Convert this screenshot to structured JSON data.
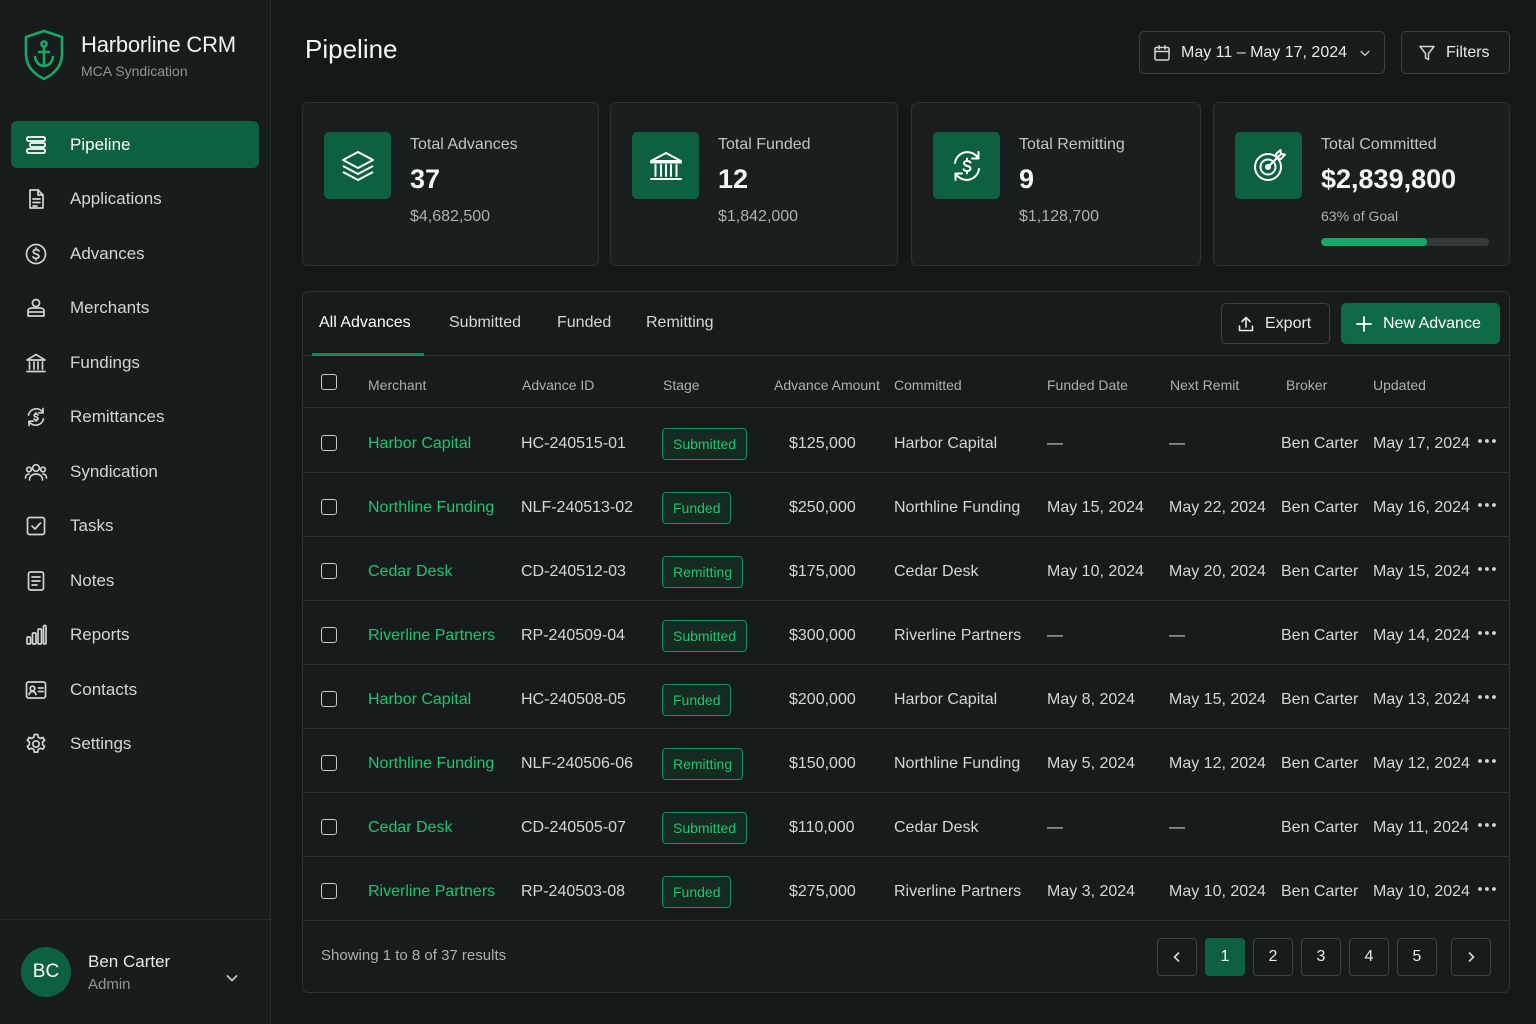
{
  "brand": {
    "title": "Harborline CRM",
    "subtitle": "MCA Syndication"
  },
  "nav": [
    {
      "label": "Pipeline",
      "icon": "pipeline-icon",
      "active": true
    },
    {
      "label": "Applications",
      "icon": "document-icon"
    },
    {
      "label": "Advances",
      "icon": "dollar-circle-icon"
    },
    {
      "label": "Merchants",
      "icon": "merchant-icon"
    },
    {
      "label": "Fundings",
      "icon": "bank-icon"
    },
    {
      "label": "Remittances",
      "icon": "refresh-dollar-icon"
    },
    {
      "label": "Syndication",
      "icon": "users-icon"
    },
    {
      "label": "Tasks",
      "icon": "checkbox-icon"
    },
    {
      "label": "Notes",
      "icon": "notes-icon"
    },
    {
      "label": "Reports",
      "icon": "bar-chart-icon"
    },
    {
      "label": "Contacts",
      "icon": "contact-card-icon"
    },
    {
      "label": "Settings",
      "icon": "gear-icon"
    }
  ],
  "user": {
    "initials": "BC",
    "name": "Ben Carter",
    "role": "Admin"
  },
  "header": {
    "title": "Pipeline",
    "date_range": "May 11 – May 17, 2024",
    "filters_label": "Filters"
  },
  "cards": [
    {
      "label": "Total Advances",
      "value": "37",
      "sub": "$4,682,500",
      "icon": "layers-icon"
    },
    {
      "label": "Total Funded",
      "value": "12",
      "sub": "$1,842,000",
      "icon": "bank-icon"
    },
    {
      "label": "Total Remitting",
      "value": "9",
      "sub": "$1,128,700",
      "icon": "refresh-dollar-icon"
    },
    {
      "label": "Total Committed",
      "value": "$2,839,800",
      "sub": "63% of Goal",
      "progress": 0.63,
      "icon": "target-icon"
    }
  ],
  "tabs": [
    {
      "label": "All Advances",
      "active": true
    },
    {
      "label": "Submitted"
    },
    {
      "label": "Funded"
    },
    {
      "label": "Remitting"
    }
  ],
  "actions": {
    "export": "Export",
    "new_advance": "New Advance"
  },
  "columns": [
    "Merchant",
    "Advance ID",
    "Stage",
    "Advance Amount",
    "Committed",
    "Funded Date",
    "Next Remit",
    "Broker",
    "Updated"
  ],
  "rows": [
    {
      "merchant": "Harbor Capital",
      "id": "HC-240515-01",
      "stage": "Submitted",
      "amount": "$125,000",
      "committed": "Harbor Capital",
      "funded": "—",
      "next": "—",
      "broker": "Ben Carter",
      "updated": "May 17, 2024"
    },
    {
      "merchant": "Northline Funding",
      "id": "NLF-240513-02",
      "stage": "Funded",
      "amount": "$250,000",
      "committed": "Northline Funding",
      "funded": "May 15, 2024",
      "next": "May 22, 2024",
      "broker": "Ben Carter",
      "updated": "May 16, 2024"
    },
    {
      "merchant": "Cedar Desk",
      "id": "CD-240512-03",
      "stage": "Remitting",
      "amount": "$175,000",
      "committed": "Cedar Desk",
      "funded": "May 10, 2024",
      "next": "May 20, 2024",
      "broker": "Ben Carter",
      "updated": "May 15, 2024"
    },
    {
      "merchant": "Riverline Partners",
      "id": "RP-240509-04",
      "stage": "Submitted",
      "amount": "$300,000",
      "committed": "Riverline Partners",
      "funded": "—",
      "next": "—",
      "broker": "Ben Carter",
      "updated": "May 14, 2024"
    },
    {
      "merchant": "Harbor Capital",
      "id": "HC-240508-05",
      "stage": "Funded",
      "amount": "$200,000",
      "committed": "Harbor Capital",
      "funded": "May 8, 2024",
      "next": "May 15, 2024",
      "broker": "Ben Carter",
      "updated": "May 13, 2024"
    },
    {
      "merchant": "Northline Funding",
      "id": "NLF-240506-06",
      "stage": "Remitting",
      "amount": "$150,000",
      "committed": "Northline Funding",
      "funded": "May 5, 2024",
      "next": "May 12, 2024",
      "broker": "Ben Carter",
      "updated": "May 12, 2024"
    },
    {
      "merchant": "Cedar Desk",
      "id": "CD-240505-07",
      "stage": "Submitted",
      "amount": "$110,000",
      "committed": "Cedar Desk",
      "funded": "—",
      "next": "—",
      "broker": "Ben Carter",
      "updated": "May 11, 2024"
    },
    {
      "merchant": "Riverline Partners",
      "id": "RP-240503-08",
      "stage": "Funded",
      "amount": "$275,000",
      "committed": "Riverline Partners",
      "funded": "May 3, 2024",
      "next": "May 10, 2024",
      "broker": "Ben Carter",
      "updated": "May 10, 2024"
    }
  ],
  "pagination": {
    "showing": "Showing  1 to 8 of 37 results",
    "pages": [
      "1",
      "2",
      "3",
      "4",
      "5"
    ],
    "current": "1"
  },
  "colors": {
    "accent": "#0e6140",
    "accent_text": "#20c472",
    "background": "#151818"
  }
}
